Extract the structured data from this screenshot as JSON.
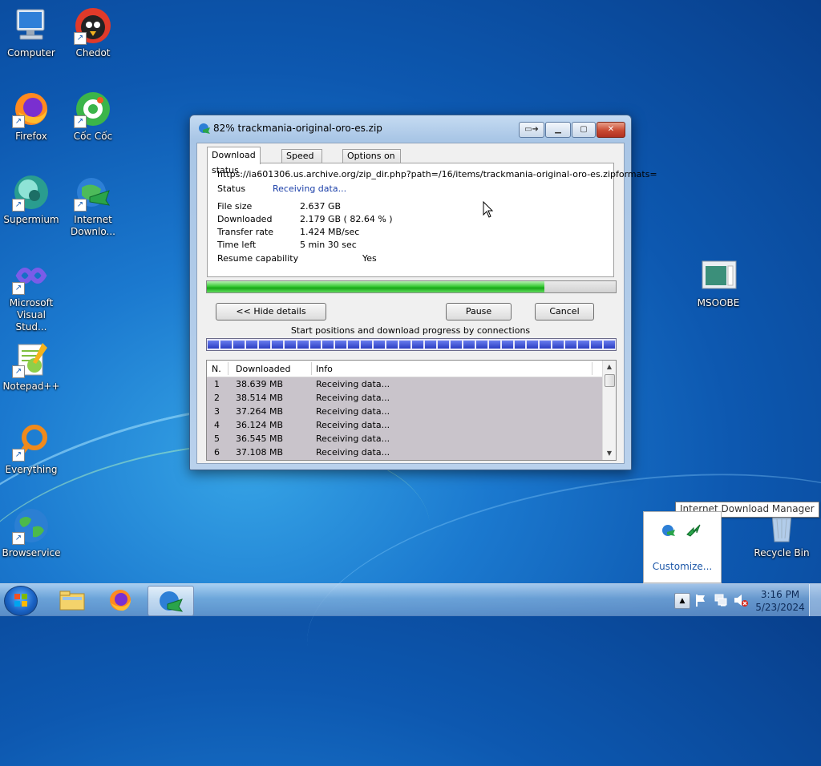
{
  "desktop": {
    "icons": [
      {
        "label": "Computer",
        "icon": "computer-icon"
      },
      {
        "label": "Chedot",
        "icon": "chedot-icon"
      },
      {
        "label": "Firefox",
        "icon": "firefox-icon"
      },
      {
        "label": "Cốc Cốc",
        "icon": "coccoc-icon"
      },
      {
        "label": "Supermium",
        "icon": "supermium-icon"
      },
      {
        "label": "Internet Downlo...",
        "icon": "idm-icon"
      },
      {
        "label": "Microsoft Visual Stud...",
        "icon": "visual-studio-icon"
      },
      {
        "label": "Notepad++",
        "icon": "notepadpp-icon"
      },
      {
        "label": "Everything",
        "icon": "everything-icon"
      },
      {
        "label": "Browservice",
        "icon": "browservice-icon"
      },
      {
        "label": "MSOOBE",
        "icon": "msoobe-icon"
      },
      {
        "label": "Recycle Bin",
        "icon": "recycle-bin-icon"
      }
    ]
  },
  "window": {
    "title": "82% trackmania-original-oro-es.zip",
    "tabs": [
      "Download status",
      "Speed Limiter",
      "Options on completion"
    ],
    "url": "https://ia601306.us.archive.org/zip_dir.php?path=/16/items/trackmania-original-oro-es.zipformats=",
    "status_label": "Status",
    "status_value": "Receiving data...",
    "details": [
      {
        "label": "File size",
        "value": "2.637  GB"
      },
      {
        "label": "Downloaded",
        "value": "2.179  GB  ( 82.64 % )"
      },
      {
        "label": "Transfer rate",
        "value": "1.424  MB/sec"
      },
      {
        "label": "Time left",
        "value": "5 min 30 sec"
      }
    ],
    "resume_label": "Resume capability",
    "resume_value": "Yes",
    "progress_fraction": 0.8264,
    "buttons": {
      "hide_details": "<< Hide details",
      "pause": "Pause",
      "cancel": "Cancel"
    },
    "connections_label": "Start positions and download progress by connections",
    "connection_segments": 32,
    "table": {
      "headers": [
        "N.",
        "Downloaded",
        "Info"
      ],
      "rows": [
        [
          "1",
          "38.639  MB",
          "Receiving data..."
        ],
        [
          "2",
          "38.514  MB",
          "Receiving data..."
        ],
        [
          "3",
          "37.264  MB",
          "Receiving data..."
        ],
        [
          "4",
          "36.124  MB",
          "Receiving data..."
        ],
        [
          "5",
          "36.545  MB",
          "Receiving data..."
        ],
        [
          "6",
          "37.108  MB",
          "Receiving data..."
        ]
      ]
    }
  },
  "tooltip": "Internet Download Manager",
  "tray_popup": {
    "customize": "Customize..."
  },
  "taskbar": {
    "time": "3:16 PM",
    "date": "5/23/2024"
  }
}
